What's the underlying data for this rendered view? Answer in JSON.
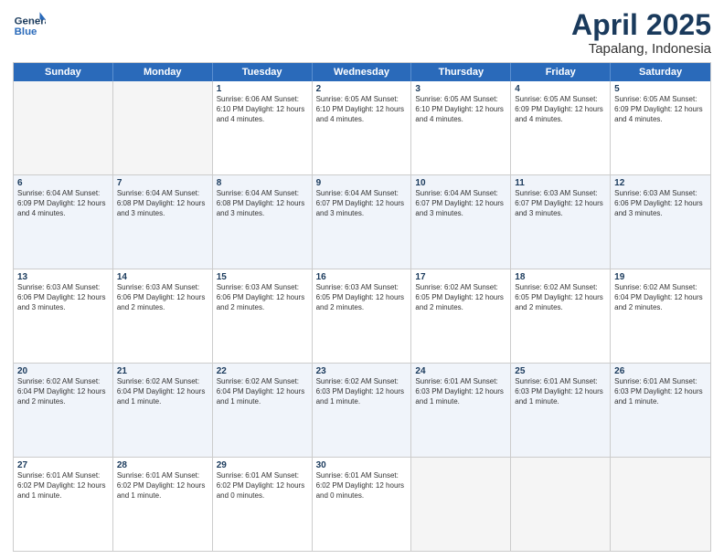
{
  "logo": {
    "line1": "General",
    "line2": "Blue"
  },
  "title": "April 2025",
  "subtitle": "Tapalang, Indonesia",
  "weekdays": [
    "Sunday",
    "Monday",
    "Tuesday",
    "Wednesday",
    "Thursday",
    "Friday",
    "Saturday"
  ],
  "rows": [
    [
      {
        "day": "",
        "info": ""
      },
      {
        "day": "",
        "info": ""
      },
      {
        "day": "1",
        "info": "Sunrise: 6:06 AM\nSunset: 6:10 PM\nDaylight: 12 hours\nand 4 minutes."
      },
      {
        "day": "2",
        "info": "Sunrise: 6:05 AM\nSunset: 6:10 PM\nDaylight: 12 hours\nand 4 minutes."
      },
      {
        "day": "3",
        "info": "Sunrise: 6:05 AM\nSunset: 6:10 PM\nDaylight: 12 hours\nand 4 minutes."
      },
      {
        "day": "4",
        "info": "Sunrise: 6:05 AM\nSunset: 6:09 PM\nDaylight: 12 hours\nand 4 minutes."
      },
      {
        "day": "5",
        "info": "Sunrise: 6:05 AM\nSunset: 6:09 PM\nDaylight: 12 hours\nand 4 minutes."
      }
    ],
    [
      {
        "day": "6",
        "info": "Sunrise: 6:04 AM\nSunset: 6:09 PM\nDaylight: 12 hours\nand 4 minutes."
      },
      {
        "day": "7",
        "info": "Sunrise: 6:04 AM\nSunset: 6:08 PM\nDaylight: 12 hours\nand 3 minutes."
      },
      {
        "day": "8",
        "info": "Sunrise: 6:04 AM\nSunset: 6:08 PM\nDaylight: 12 hours\nand 3 minutes."
      },
      {
        "day": "9",
        "info": "Sunrise: 6:04 AM\nSunset: 6:07 PM\nDaylight: 12 hours\nand 3 minutes."
      },
      {
        "day": "10",
        "info": "Sunrise: 6:04 AM\nSunset: 6:07 PM\nDaylight: 12 hours\nand 3 minutes."
      },
      {
        "day": "11",
        "info": "Sunrise: 6:03 AM\nSunset: 6:07 PM\nDaylight: 12 hours\nand 3 minutes."
      },
      {
        "day": "12",
        "info": "Sunrise: 6:03 AM\nSunset: 6:06 PM\nDaylight: 12 hours\nand 3 minutes."
      }
    ],
    [
      {
        "day": "13",
        "info": "Sunrise: 6:03 AM\nSunset: 6:06 PM\nDaylight: 12 hours\nand 3 minutes."
      },
      {
        "day": "14",
        "info": "Sunrise: 6:03 AM\nSunset: 6:06 PM\nDaylight: 12 hours\nand 2 minutes."
      },
      {
        "day": "15",
        "info": "Sunrise: 6:03 AM\nSunset: 6:06 PM\nDaylight: 12 hours\nand 2 minutes."
      },
      {
        "day": "16",
        "info": "Sunrise: 6:03 AM\nSunset: 6:05 PM\nDaylight: 12 hours\nand 2 minutes."
      },
      {
        "day": "17",
        "info": "Sunrise: 6:02 AM\nSunset: 6:05 PM\nDaylight: 12 hours\nand 2 minutes."
      },
      {
        "day": "18",
        "info": "Sunrise: 6:02 AM\nSunset: 6:05 PM\nDaylight: 12 hours\nand 2 minutes."
      },
      {
        "day": "19",
        "info": "Sunrise: 6:02 AM\nSunset: 6:04 PM\nDaylight: 12 hours\nand 2 minutes."
      }
    ],
    [
      {
        "day": "20",
        "info": "Sunrise: 6:02 AM\nSunset: 6:04 PM\nDaylight: 12 hours\nand 2 minutes."
      },
      {
        "day": "21",
        "info": "Sunrise: 6:02 AM\nSunset: 6:04 PM\nDaylight: 12 hours\nand 1 minute."
      },
      {
        "day": "22",
        "info": "Sunrise: 6:02 AM\nSunset: 6:04 PM\nDaylight: 12 hours\nand 1 minute."
      },
      {
        "day": "23",
        "info": "Sunrise: 6:02 AM\nSunset: 6:03 PM\nDaylight: 12 hours\nand 1 minute."
      },
      {
        "day": "24",
        "info": "Sunrise: 6:01 AM\nSunset: 6:03 PM\nDaylight: 12 hours\nand 1 minute."
      },
      {
        "day": "25",
        "info": "Sunrise: 6:01 AM\nSunset: 6:03 PM\nDaylight: 12 hours\nand 1 minute."
      },
      {
        "day": "26",
        "info": "Sunrise: 6:01 AM\nSunset: 6:03 PM\nDaylight: 12 hours\nand 1 minute."
      }
    ],
    [
      {
        "day": "27",
        "info": "Sunrise: 6:01 AM\nSunset: 6:02 PM\nDaylight: 12 hours\nand 1 minute."
      },
      {
        "day": "28",
        "info": "Sunrise: 6:01 AM\nSunset: 6:02 PM\nDaylight: 12 hours\nand 1 minute."
      },
      {
        "day": "29",
        "info": "Sunrise: 6:01 AM\nSunset: 6:02 PM\nDaylight: 12 hours\nand 0 minutes."
      },
      {
        "day": "30",
        "info": "Sunrise: 6:01 AM\nSunset: 6:02 PM\nDaylight: 12 hours\nand 0 minutes."
      },
      {
        "day": "",
        "info": ""
      },
      {
        "day": "",
        "info": ""
      },
      {
        "day": "",
        "info": ""
      }
    ]
  ]
}
